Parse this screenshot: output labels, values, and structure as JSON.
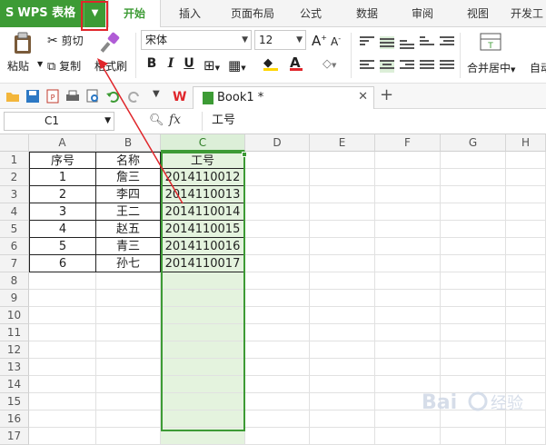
{
  "app": {
    "name": "WPS 表格",
    "logo_letter": "S"
  },
  "tabs": [
    "开始",
    "插入",
    "页面布局",
    "公式",
    "数据",
    "审阅",
    "视图",
    "开发工"
  ],
  "active_tab_index": 0,
  "ribbon": {
    "paste_label": "粘贴",
    "cut_label": "剪切",
    "copy_label": "复制",
    "format_painter_label": "格式刷",
    "font_name": "宋体",
    "font_size": "12",
    "bold": "B",
    "italic": "I",
    "underline": "U",
    "merge_center_label": "合并居中",
    "auto_wrap_label": "自动"
  },
  "document": {
    "tab_name": "Book1 *"
  },
  "formula_bar": {
    "cell_ref": "C1",
    "fx_label": "fx",
    "value": "工号"
  },
  "sheet": {
    "column_headers": [
      "A",
      "B",
      "C",
      "D",
      "E",
      "F",
      "G",
      "H"
    ],
    "row_numbers": [
      "1",
      "2",
      "3",
      "4",
      "5",
      "6",
      "7",
      "8",
      "9",
      "10",
      "11",
      "12",
      "13",
      "14",
      "15",
      "16",
      "17"
    ],
    "selected_column": "C",
    "rows": [
      [
        "序号",
        "名称",
        "工号"
      ],
      [
        "1",
        "詹三",
        "2014110012"
      ],
      [
        "2",
        "李四",
        "2014110013"
      ],
      [
        "3",
        "王二",
        "2014110014"
      ],
      [
        "4",
        "赵五",
        "2014110015"
      ],
      [
        "5",
        "青三",
        "2014110016"
      ],
      [
        "6",
        "孙七",
        "2014110017"
      ]
    ]
  },
  "colors": {
    "brand": "#3d9b35",
    "annotation": "#e0262b",
    "selection_fill": "#e4f3de"
  },
  "watermark": "Baidu 经验"
}
